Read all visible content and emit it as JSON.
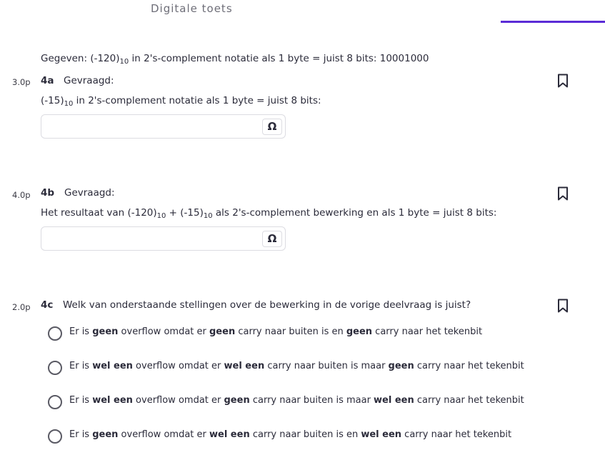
{
  "header": {
    "title": "Digitale toets"
  },
  "given": {
    "prefix": "Gegeven: (-120)",
    "sub": "10",
    "suffix": " in 2's-complement notatie als 1 byte = juist 8 bits: 10001000"
  },
  "questions": [
    {
      "points": "3.0p",
      "number": "4a",
      "heading": "Gevraagd:",
      "text_prefix": "(-15)",
      "text_sub": "10",
      "text_suffix": " in 2's-complement notatie als 1 byte = juist 8 bits:",
      "answer_value": "",
      "omega_label": "Ω",
      "icon": "bookmark-icon"
    },
    {
      "points": "4.0p",
      "number": "4b",
      "heading": "Gevraagd:",
      "text_part1": "Het resultaat van (-120)",
      "text_sub1": "10",
      "text_part2": " + (-15)",
      "text_sub2": "10",
      "text_part3": " als 2's-complement bewerking en als 1 byte = juist 8 bits:",
      "answer_value": "",
      "omega_label": "Ω",
      "icon": "bookmark-icon"
    },
    {
      "points": "2.0p",
      "number": "4c",
      "heading": "Welk van onderstaande stellingen over de bewerking in de vorige deelvraag is juist?",
      "icon": "bookmark-icon",
      "options": [
        {
          "segments": [
            {
              "t": "Er is ",
              "b": false
            },
            {
              "t": "geen",
              "b": true
            },
            {
              "t": " overflow omdat er ",
              "b": false
            },
            {
              "t": "geen",
              "b": true
            },
            {
              "t": " carry naar buiten is en ",
              "b": false
            },
            {
              "t": "geen",
              "b": true
            },
            {
              "t": " carry naar het tekenbit",
              "b": false
            }
          ]
        },
        {
          "segments": [
            {
              "t": "Er is ",
              "b": false
            },
            {
              "t": "wel een",
              "b": true
            },
            {
              "t": " overflow omdat er ",
              "b": false
            },
            {
              "t": "wel een",
              "b": true
            },
            {
              "t": " carry naar buiten is maar ",
              "b": false
            },
            {
              "t": "geen",
              "b": true
            },
            {
              "t": " carry naar het tekenbit",
              "b": false
            }
          ]
        },
        {
          "segments": [
            {
              "t": "Er is ",
              "b": false
            },
            {
              "t": "wel een",
              "b": true
            },
            {
              "t": " overflow omdat er ",
              "b": false
            },
            {
              "t": "geen",
              "b": true
            },
            {
              "t": " carry naar buiten is maar ",
              "b": false
            },
            {
              "t": "wel een",
              "b": true
            },
            {
              "t": " carry naar het tekenbit",
              "b": false
            }
          ]
        },
        {
          "segments": [
            {
              "t": "Er is ",
              "b": false
            },
            {
              "t": "geen",
              "b": true
            },
            {
              "t": " overflow omdat er ",
              "b": false
            },
            {
              "t": "wel een",
              "b": true
            },
            {
              "t": " carry naar buiten is en ",
              "b": false
            },
            {
              "t": "wel een",
              "b": true
            },
            {
              "t": " carry naar het tekenbit",
              "b": false
            }
          ]
        }
      ]
    }
  ]
}
